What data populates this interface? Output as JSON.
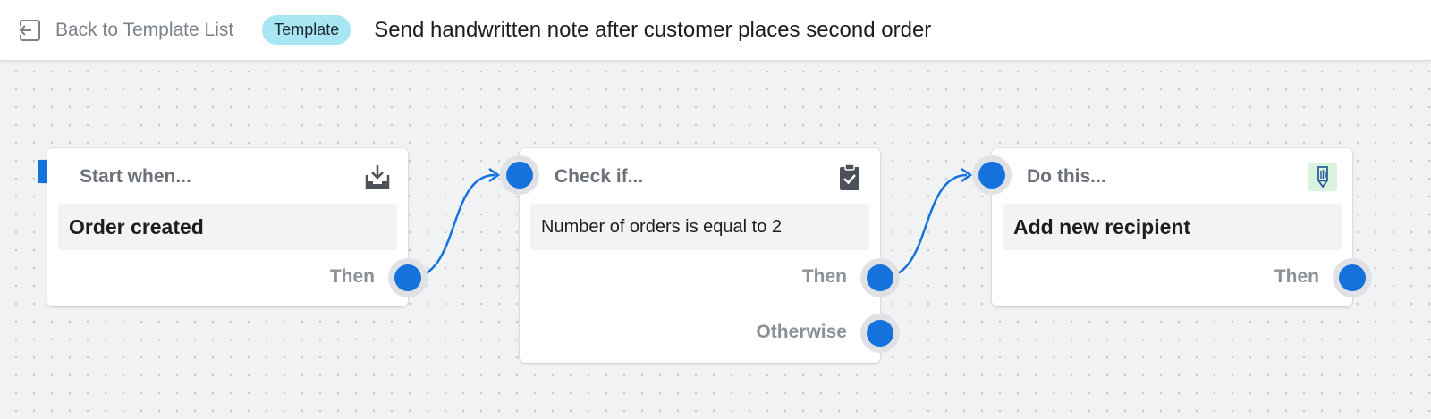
{
  "header": {
    "back_label": "Back to Template List",
    "badge_label": "Template",
    "title": "Send handwritten note after customer places second order"
  },
  "nodes": [
    {
      "header": "Start when...",
      "body": "Order created",
      "outputs": [
        "Then"
      ],
      "icon": "download-tray-icon"
    },
    {
      "header": "Check if...",
      "body": "Number of orders is equal to 2",
      "outputs": [
        "Then",
        "Otherwise"
      ],
      "icon": "clipboard-check-icon"
    },
    {
      "header": "Do this...",
      "body": "Add new recipient",
      "outputs": [
        "Then"
      ],
      "icon": "handwritten-pen-icon"
    }
  ],
  "colors": {
    "accent": "#1572dd",
    "badge_bg": "#a7e6f2",
    "canvas_bg": "#f1f2f4",
    "pen_icon_bg": "#d9f3df"
  }
}
